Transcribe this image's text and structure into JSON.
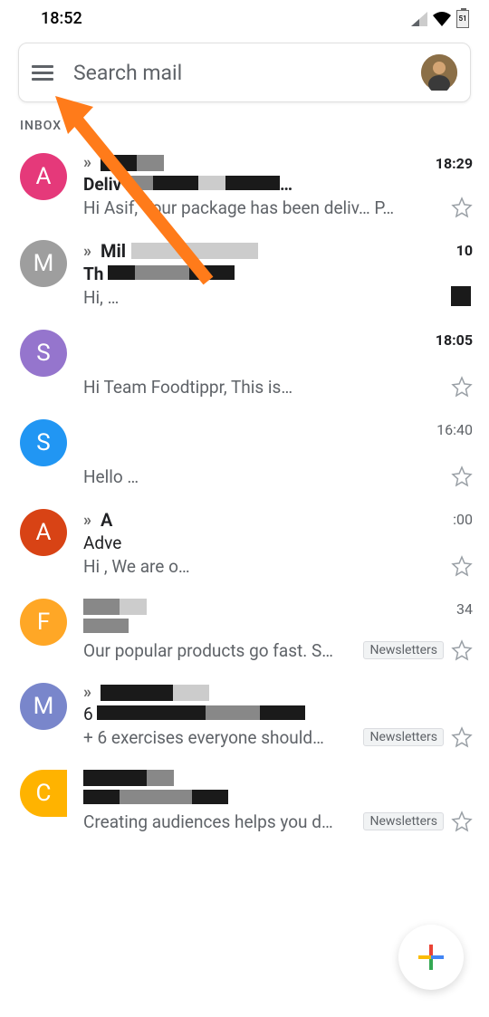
{
  "status_bar": {
    "time": "18:52",
    "battery": "51"
  },
  "search": {
    "placeholder": "Search mail"
  },
  "section_label": "INBOX",
  "emails": [
    {
      "initial": "A",
      "avatar_color": "#e5397a",
      "chevrons": true,
      "sender": "",
      "subject": "Deliv",
      "snippet": "Hi Asif, Your package has been deliv… P…",
      "time": "18:29",
      "unread": true,
      "starred": false
    },
    {
      "initial": "M",
      "avatar_color": "#9e9e9e",
      "chevrons": true,
      "sender": "Mil",
      "subject": "Th",
      "snippet": "Hi, …",
      "time": "10",
      "unread": true,
      "starred": false
    },
    {
      "initial": "S",
      "avatar_color": "#9575cd",
      "chevrons": false,
      "sender": "",
      "subject": "",
      "snippet": "Hi Team Foodtippr, This is…",
      "time": "18:05",
      "unread": true,
      "starred": false
    },
    {
      "initial": "S",
      "avatar_color": "#2196f3",
      "chevrons": false,
      "sender": "",
      "subject": "",
      "snippet": "Hello …",
      "time": "16:40",
      "unread": false,
      "starred": false
    },
    {
      "initial": "A",
      "avatar_color": "#d84315",
      "chevrons": true,
      "sender": "A",
      "subject": "Adve",
      "snippet": "Hi , We are o…",
      "time": ":00",
      "unread": false,
      "starred": false
    },
    {
      "initial": "F",
      "avatar_color": "#ffa726",
      "chevrons": false,
      "sender": "",
      "subject": "",
      "snippet": "Our popular products go fast. S…",
      "time": "34",
      "unread": false,
      "starred": false,
      "label": "Newsletters"
    },
    {
      "initial": "M",
      "avatar_color": "#7986cb",
      "chevrons": true,
      "sender": "",
      "subject": "6",
      "snippet": "+ 6 exercises everyone should…",
      "time": "",
      "unread": false,
      "starred": false,
      "label": "Newsletters"
    },
    {
      "initial": "C",
      "avatar_color": "#ffb300",
      "chevrons": false,
      "sender": "",
      "subject": "",
      "snippet": "Creating audiences helps you d…",
      "time": "",
      "unread": false,
      "starred": false,
      "label": "Newsletters"
    }
  ],
  "labels": {
    "newsletters": "Newsletters"
  }
}
